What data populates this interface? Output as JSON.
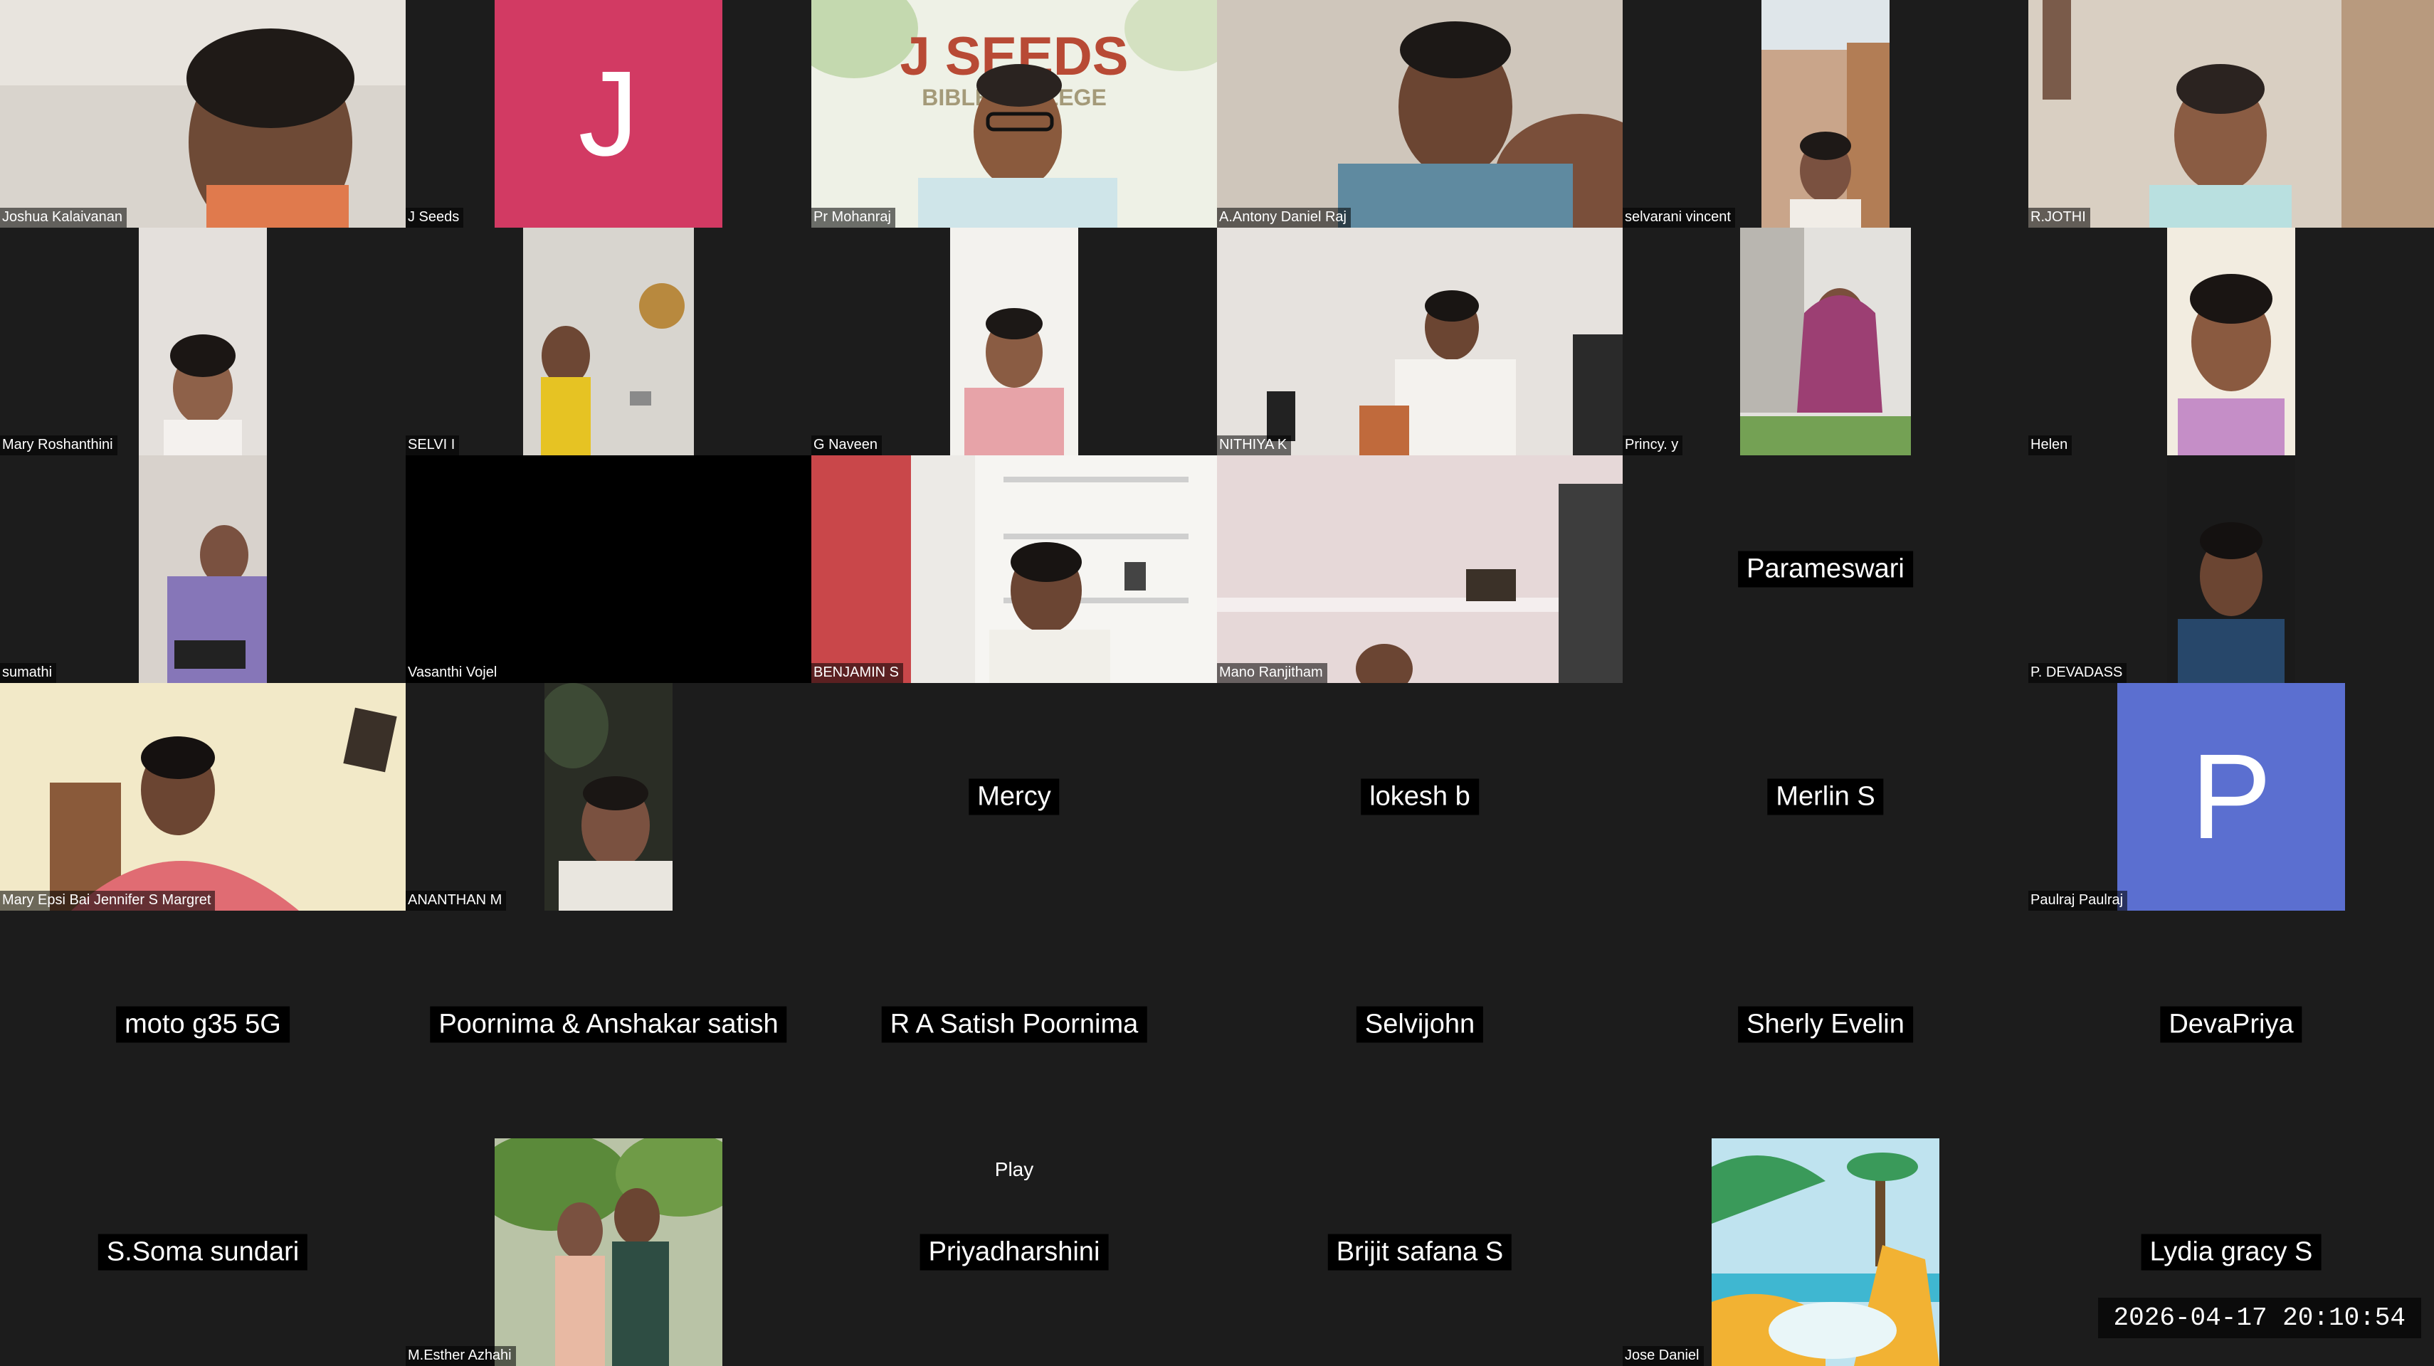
{
  "meeting": {
    "timestamp": "2026-04-17 20:10:54"
  },
  "tiles": [
    {
      "name": "Joshua Kalaivanan",
      "kind": "video"
    },
    {
      "name": "J Seeds",
      "kind": "avatar",
      "letter": "J",
      "avatar_color": "#d23a63"
    },
    {
      "name": "Pr Mohanraj",
      "kind": "video",
      "banner": "J SEEDS",
      "banner_sub": "BIBLE COLLEGE"
    },
    {
      "name": "A.Antony Daniel Raj",
      "kind": "video"
    },
    {
      "name": "selvarani vincent",
      "kind": "video"
    },
    {
      "name": "R.JOTHI",
      "kind": "video"
    },
    {
      "name": "Mary Roshanthini",
      "kind": "video"
    },
    {
      "name": "SELVI I",
      "kind": "video"
    },
    {
      "name": "G Naveen",
      "kind": "video"
    },
    {
      "name": "NITHIYA K",
      "kind": "video"
    },
    {
      "name": "Princy. y",
      "kind": "video"
    },
    {
      "name": "Helen",
      "kind": "video"
    },
    {
      "name": "sumathi",
      "kind": "video"
    },
    {
      "name": "Vasanthi Vojel",
      "kind": "video-off"
    },
    {
      "name": "BENJAMIN S",
      "kind": "video"
    },
    {
      "name": "Mano Ranjitham",
      "kind": "video"
    },
    {
      "name": "Parameswari",
      "kind": "name-only"
    },
    {
      "name": "P. DEVADASS",
      "kind": "video"
    },
    {
      "name": "Mary Epsi Bai Jennifer S Margret",
      "kind": "video"
    },
    {
      "name": "ANANTHAN M",
      "kind": "video"
    },
    {
      "name": "Mercy",
      "kind": "name-only"
    },
    {
      "name": "lokesh b",
      "kind": "name-only"
    },
    {
      "name": "Merlin S",
      "kind": "name-only"
    },
    {
      "name": "Paulraj Paulraj",
      "kind": "avatar",
      "letter": "P",
      "avatar_color": "#5b6fd0"
    },
    {
      "name": "moto g35 5G",
      "kind": "name-only"
    },
    {
      "name": "Poornima & Anshakar satish",
      "kind": "name-only"
    },
    {
      "name": "R A Satish Poornima",
      "kind": "name-only"
    },
    {
      "name": "Selvijohn",
      "kind": "name-only"
    },
    {
      "name": "Sherly Evelin",
      "kind": "name-only"
    },
    {
      "name": "DevaPriya",
      "kind": "name-only"
    },
    {
      "name": "S.Soma sundari",
      "kind": "name-only"
    },
    {
      "name": "M.Esther Azhahi",
      "kind": "video"
    },
    {
      "name": "Priyadharshini",
      "kind": "name-only",
      "overlay": "Play"
    },
    {
      "name": "Brijit safana S",
      "kind": "name-only"
    },
    {
      "name": "Jose Daniel",
      "kind": "video"
    },
    {
      "name": "Lydia gracy S",
      "kind": "name-only"
    }
  ]
}
